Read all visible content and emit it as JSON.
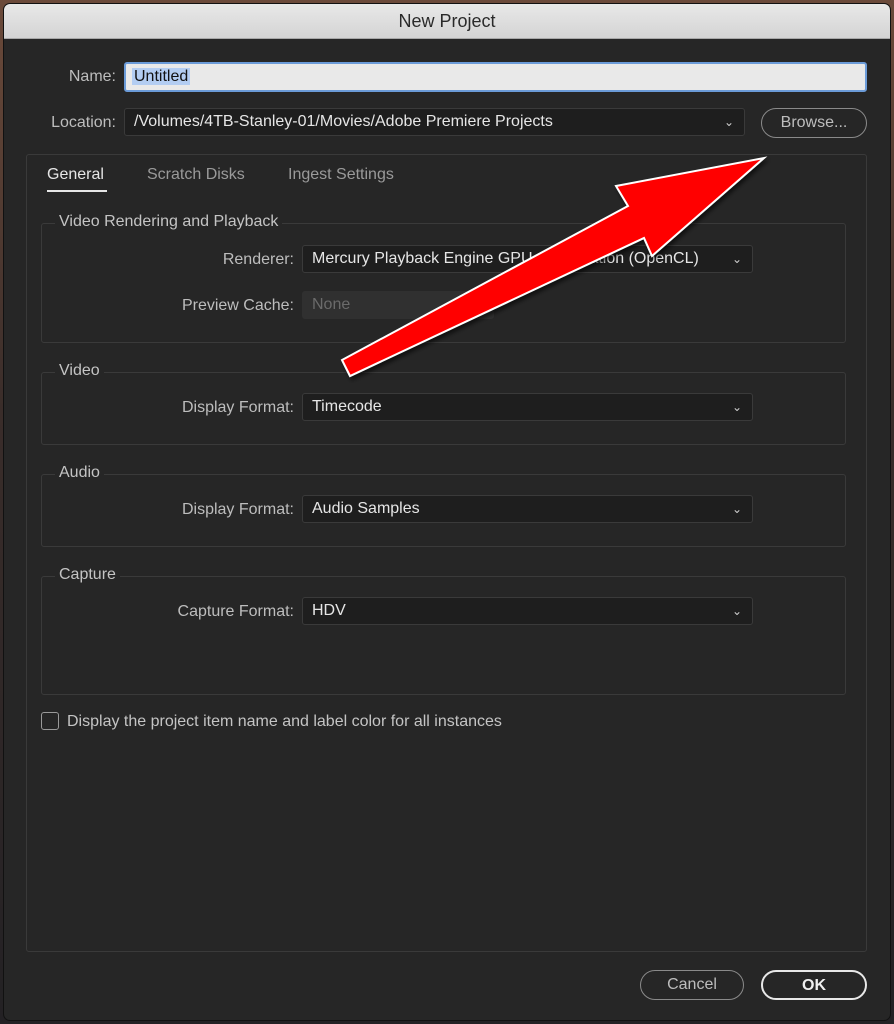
{
  "window": {
    "title": "New Project"
  },
  "name": {
    "label": "Name:",
    "value": "Untitled"
  },
  "location": {
    "label": "Location:",
    "value": "/Volumes/4TB-Stanley-01/Movies/Adobe Premiere Projects",
    "browse_label": "Browse..."
  },
  "tabs": [
    {
      "label": "General",
      "active": true
    },
    {
      "label": "Scratch Disks",
      "active": false
    },
    {
      "label": "Ingest Settings",
      "active": false
    }
  ],
  "video_rendering": {
    "title": "Video Rendering and Playback",
    "renderer_label": "Renderer:",
    "renderer_value": "Mercury Playback Engine GPU Acceleration (OpenCL)",
    "preview_cache_label": "Preview Cache:",
    "preview_cache_value": "None"
  },
  "video": {
    "title": "Video",
    "display_format_label": "Display Format:",
    "display_format_value": "Timecode"
  },
  "audio": {
    "title": "Audio",
    "display_format_label": "Display Format:",
    "display_format_value": "Audio Samples"
  },
  "capture": {
    "title": "Capture",
    "capture_format_label": "Capture Format:",
    "capture_format_value": "HDV"
  },
  "checkbox": {
    "label": "Display the project item name and label color for all instances",
    "checked": false
  },
  "buttons": {
    "cancel_label": "Cancel",
    "ok_label": "OK"
  },
  "colors": {
    "dialog_bg": "#262626",
    "annotation_arrow": "#ff0000",
    "focus_ring": "#6b9bd8"
  }
}
